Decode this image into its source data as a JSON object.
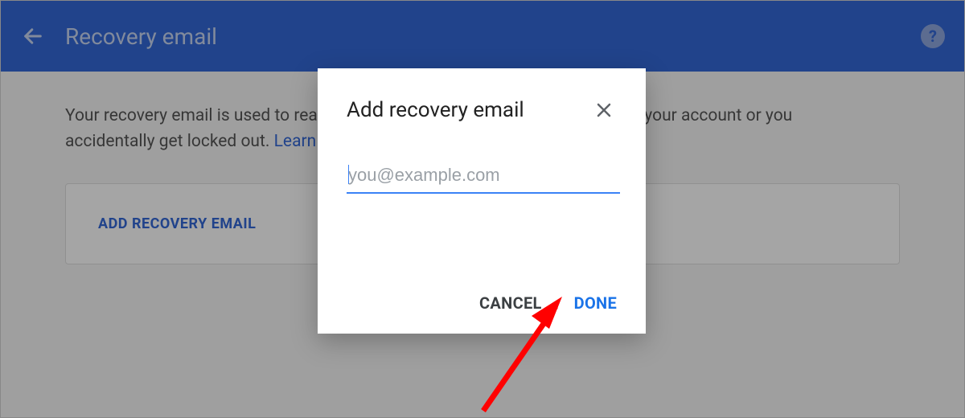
{
  "header": {
    "title": "Recovery email"
  },
  "page": {
    "desc_prefix": "Your recovery email is used to reach you in case we detect unusual activity in your account or you accidentally get locked out. ",
    "learn_more": "Learn more",
    "add_button": "ADD RECOVERY EMAIL"
  },
  "dialog": {
    "title": "Add recovery email",
    "placeholder": "you@example.com",
    "value": "",
    "cancel": "CANCEL",
    "done": "DONE"
  },
  "icons": {
    "help_glyph": "?"
  }
}
